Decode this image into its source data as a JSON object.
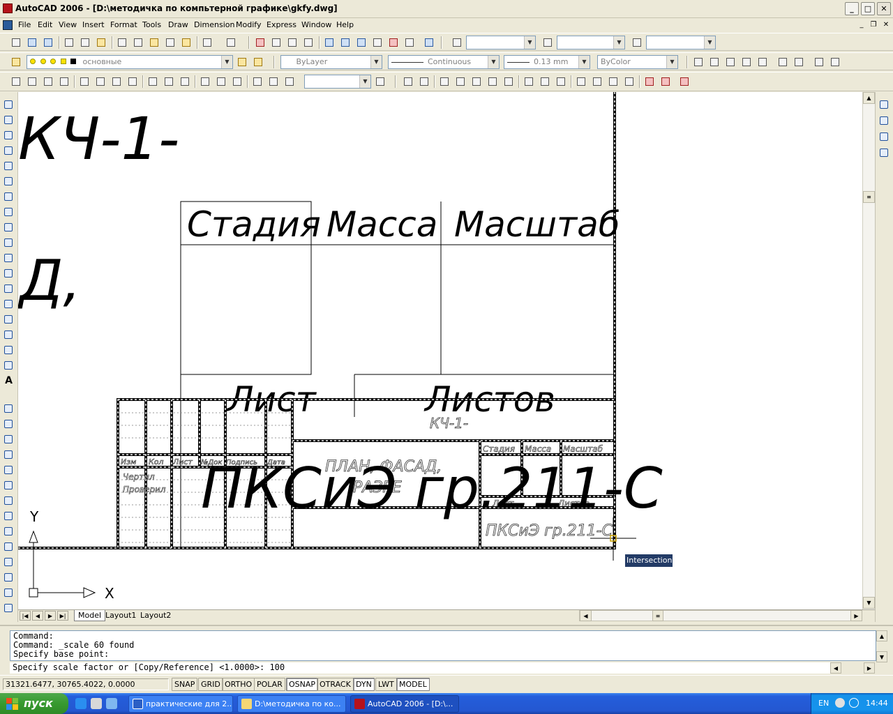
{
  "window": {
    "title": "AutoCAD 2006 - [D:\\методичка по компьтерной графике\\gkfy.dwg]"
  },
  "menu": [
    "File",
    "Edit",
    "View",
    "Insert",
    "Format",
    "Tools",
    "Draw",
    "Dimension",
    "Modify",
    "Express",
    "Window",
    "Help"
  ],
  "toolbars": {
    "layer_combo": "основные",
    "color_combo": "ByLayer",
    "linetype_combo": "Continuous",
    "lineweight_combo": "0.13 mm",
    "plotstyle_combo": "ByColor"
  },
  "drawing": {
    "big_text_1": "КЧ-1-",
    "big_text_2": "Д,",
    "cell_stage": "Стадия",
    "cell_mass": "Масса",
    "cell_scale": "Масштаб",
    "cell_sheet": "Лист",
    "cell_sheets": "Листов",
    "tb_code": "КЧ-1-",
    "tb_title_line1": "ПЛАН, ФАСАД,",
    "tb_title_line2": "РАЗРЕ",
    "big_group": "ПКСиЭ гр.211-С",
    "tb_small_stage": "Стадия",
    "tb_small_mass": "Масса",
    "tb_small_scale": "Масштаб",
    "tb_small_sheet": "Лист",
    "tb_small_sheets": "Листов",
    "tb_org": "ПКСиЭ гр.211-С",
    "tb_hdr_izm": "Изм",
    "tb_hdr_kol": "Кол",
    "tb_hdr_list": "Лист",
    "tb_hdr_doc": "№Док",
    "tb_hdr_podp": "Подпись",
    "tb_hdr_data": "Дата",
    "tb_chertil": "Чертил",
    "tb_proveril": "Проверил",
    "ucs_y": "Y",
    "ucs_x": "X",
    "snap_tooltip": "Intersection"
  },
  "layout_tabs": [
    "Model",
    "Layout1",
    "Layout2"
  ],
  "command": {
    "history": [
      "Command:",
      "Command: _scale 60 found",
      "Specify base point:"
    ],
    "current": "Specify scale factor or [Copy/Reference] <1.0000>: 100"
  },
  "status": {
    "coords": "31321.6477, 30765.4022, 0.0000",
    "buttons": [
      "SNAP",
      "GRID",
      "ORTHO",
      "POLAR",
      "OSNAP",
      "OTRACK",
      "DYN",
      "LWT",
      "MODEL"
    ],
    "on_buttons": [
      "OSNAP",
      "DYN",
      "MODEL"
    ]
  },
  "taskbar": {
    "start": "пуск",
    "tasks": [
      "практические для 2...",
      "D:\\методичка по ко...",
      "AutoCAD 2006 - [D:\\..."
    ],
    "lang": "EN",
    "clock": "14:44"
  }
}
